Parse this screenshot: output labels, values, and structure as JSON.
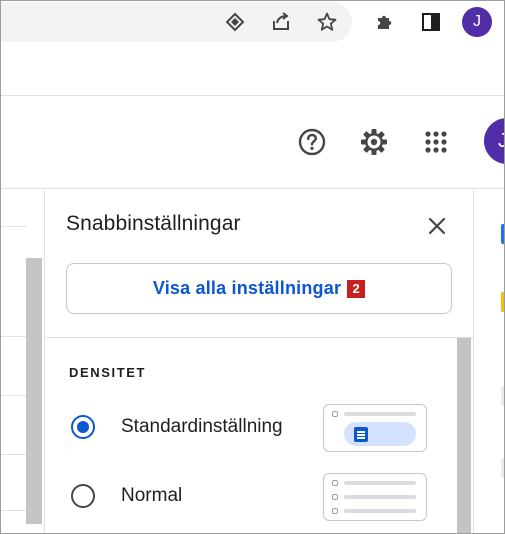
{
  "browser": {
    "profile_initial": "J",
    "icons": [
      "diamond-extension-icon",
      "share-icon",
      "bookmark-star-icon",
      "puzzle-extensions-icon",
      "side-panel-icon"
    ]
  },
  "header": {
    "icons": [
      "help-icon",
      "settings-gear-icon",
      "apps-grid-icon"
    ],
    "account_initial": "J"
  },
  "quick_settings": {
    "title": "Snabbinställningar",
    "see_all_label": "Visa alla inställningar",
    "annotation_number": "2",
    "density": {
      "heading": "DENSITET",
      "options": [
        {
          "label": "Standardinställning",
          "selected": true
        },
        {
          "label": "Normal",
          "selected": false
        }
      ]
    }
  },
  "colors": {
    "accent": "#0b57d0",
    "avatar": "#512da8",
    "badge": "#c5221f",
    "scrollbar": "#c4c4c4"
  }
}
